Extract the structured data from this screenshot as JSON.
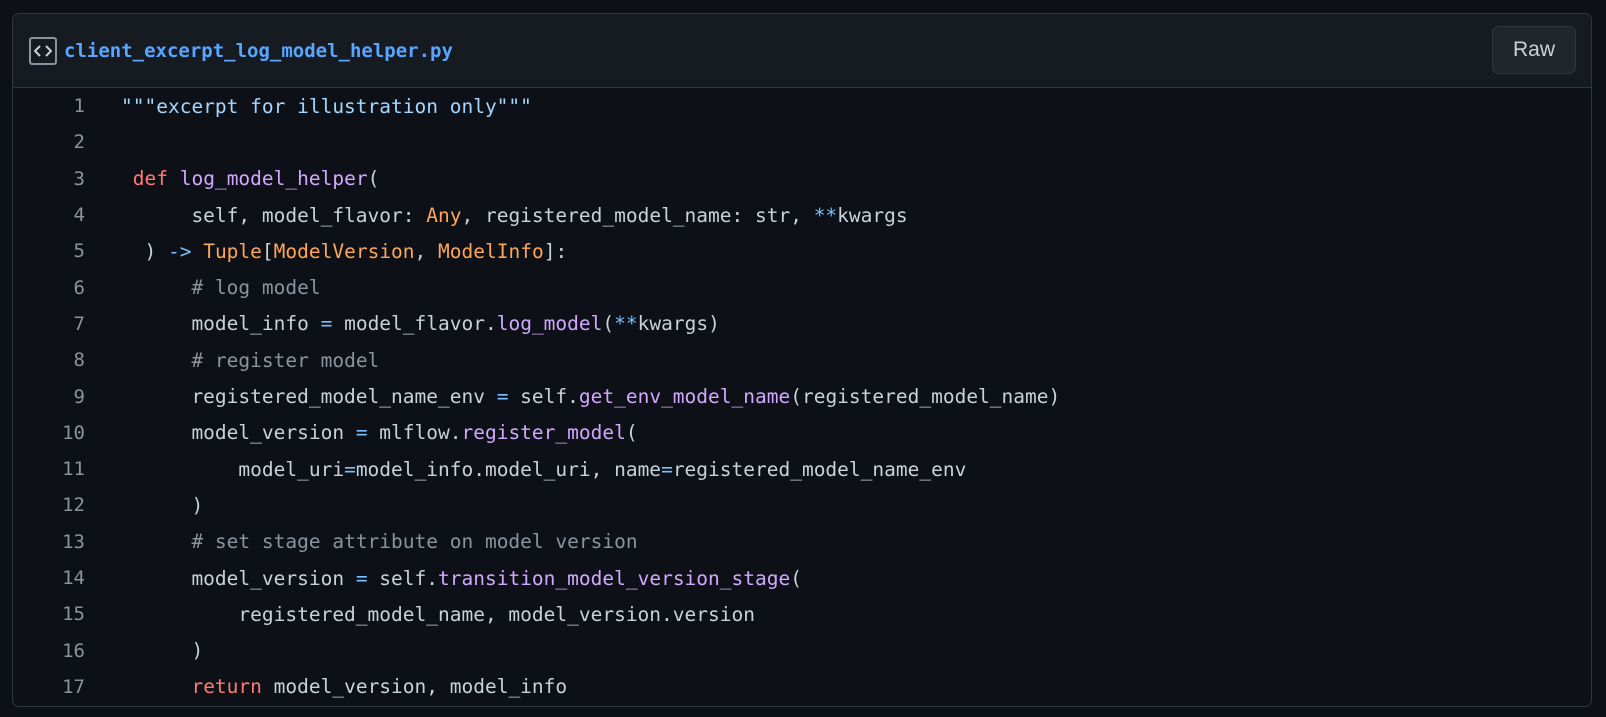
{
  "file": {
    "name": "client_excerpt_log_model_helper.py",
    "raw_label": "Raw",
    "icon": "code-square-icon"
  },
  "colors": {
    "background": "#0d1117",
    "header": "#161b22",
    "border": "#30363d",
    "filename": "#58a6ff",
    "string": "#a5d6ff",
    "keyword": "#ff7b72",
    "function": "#d2a8ff",
    "type": "#ffa657",
    "operator": "#79c0ff",
    "comment": "#8b949e",
    "text": "#c9d1d9"
  },
  "lines": [
    {
      "number": "1",
      "tokens": [
        {
          "t": "\"\"\"excerpt for illustration only\"\"\"",
          "c": "string"
        }
      ]
    },
    {
      "number": "2",
      "tokens": []
    },
    {
      "number": "3",
      "tokens": [
        {
          "t": " ",
          "c": "default"
        },
        {
          "t": "def",
          "c": "keyword"
        },
        {
          "t": " ",
          "c": "default"
        },
        {
          "t": "log_model_helper",
          "c": "function"
        },
        {
          "t": "(",
          "c": "default"
        }
      ]
    },
    {
      "number": "4",
      "tokens": [
        {
          "t": "      self, model_flavor: ",
          "c": "default"
        },
        {
          "t": "Any",
          "c": "type"
        },
        {
          "t": ", registered_model_name: str, ",
          "c": "default"
        },
        {
          "t": "**",
          "c": "operator"
        },
        {
          "t": "kwargs",
          "c": "default"
        }
      ]
    },
    {
      "number": "5",
      "tokens": [
        {
          "t": "  ) ",
          "c": "default"
        },
        {
          "t": "->",
          "c": "operator"
        },
        {
          "t": " ",
          "c": "default"
        },
        {
          "t": "Tuple",
          "c": "type"
        },
        {
          "t": "[",
          "c": "default"
        },
        {
          "t": "ModelVersion",
          "c": "type"
        },
        {
          "t": ", ",
          "c": "default"
        },
        {
          "t": "ModelInfo",
          "c": "type"
        },
        {
          "t": "]:",
          "c": "default"
        }
      ]
    },
    {
      "number": "6",
      "tokens": [
        {
          "t": "      ",
          "c": "default"
        },
        {
          "t": "# log model",
          "c": "comment"
        }
      ]
    },
    {
      "number": "7",
      "tokens": [
        {
          "t": "      model_info ",
          "c": "default"
        },
        {
          "t": "=",
          "c": "operator"
        },
        {
          "t": " model_flavor.",
          "c": "default"
        },
        {
          "t": "log_model",
          "c": "function"
        },
        {
          "t": "(",
          "c": "default"
        },
        {
          "t": "**",
          "c": "operator"
        },
        {
          "t": "kwargs)",
          "c": "default"
        }
      ]
    },
    {
      "number": "8",
      "tokens": [
        {
          "t": "      ",
          "c": "default"
        },
        {
          "t": "# register model",
          "c": "comment"
        }
      ]
    },
    {
      "number": "9",
      "tokens": [
        {
          "t": "      registered_model_name_env ",
          "c": "default"
        },
        {
          "t": "=",
          "c": "operator"
        },
        {
          "t": " self.",
          "c": "default"
        },
        {
          "t": "get_env_model_name",
          "c": "function"
        },
        {
          "t": "(registered_model_name)",
          "c": "default"
        }
      ]
    },
    {
      "number": "10",
      "tokens": [
        {
          "t": "      model_version ",
          "c": "default"
        },
        {
          "t": "=",
          "c": "operator"
        },
        {
          "t": " mlflow.",
          "c": "default"
        },
        {
          "t": "register_model",
          "c": "function"
        },
        {
          "t": "(",
          "c": "default"
        }
      ]
    },
    {
      "number": "11",
      "tokens": [
        {
          "t": "          model_uri",
          "c": "default"
        },
        {
          "t": "=",
          "c": "operator"
        },
        {
          "t": "model_info.model_uri, name",
          "c": "default"
        },
        {
          "t": "=",
          "c": "operator"
        },
        {
          "t": "registered_model_name_env",
          "c": "default"
        }
      ]
    },
    {
      "number": "12",
      "tokens": [
        {
          "t": "      )",
          "c": "default"
        }
      ]
    },
    {
      "number": "13",
      "tokens": [
        {
          "t": "      ",
          "c": "default"
        },
        {
          "t": "# set stage attribute on model version",
          "c": "comment"
        }
      ]
    },
    {
      "number": "14",
      "tokens": [
        {
          "t": "      model_version ",
          "c": "default"
        },
        {
          "t": "=",
          "c": "operator"
        },
        {
          "t": " self.",
          "c": "default"
        },
        {
          "t": "transition_model_version_stage",
          "c": "function"
        },
        {
          "t": "(",
          "c": "default"
        }
      ]
    },
    {
      "number": "15",
      "tokens": [
        {
          "t": "          registered_model_name, model_version.version",
          "c": "default"
        }
      ]
    },
    {
      "number": "16",
      "tokens": [
        {
          "t": "      )",
          "c": "default"
        }
      ]
    },
    {
      "number": "17",
      "tokens": [
        {
          "t": "      ",
          "c": "default"
        },
        {
          "t": "return",
          "c": "keyword"
        },
        {
          "t": " model_version, model_info",
          "c": "default"
        }
      ]
    }
  ]
}
